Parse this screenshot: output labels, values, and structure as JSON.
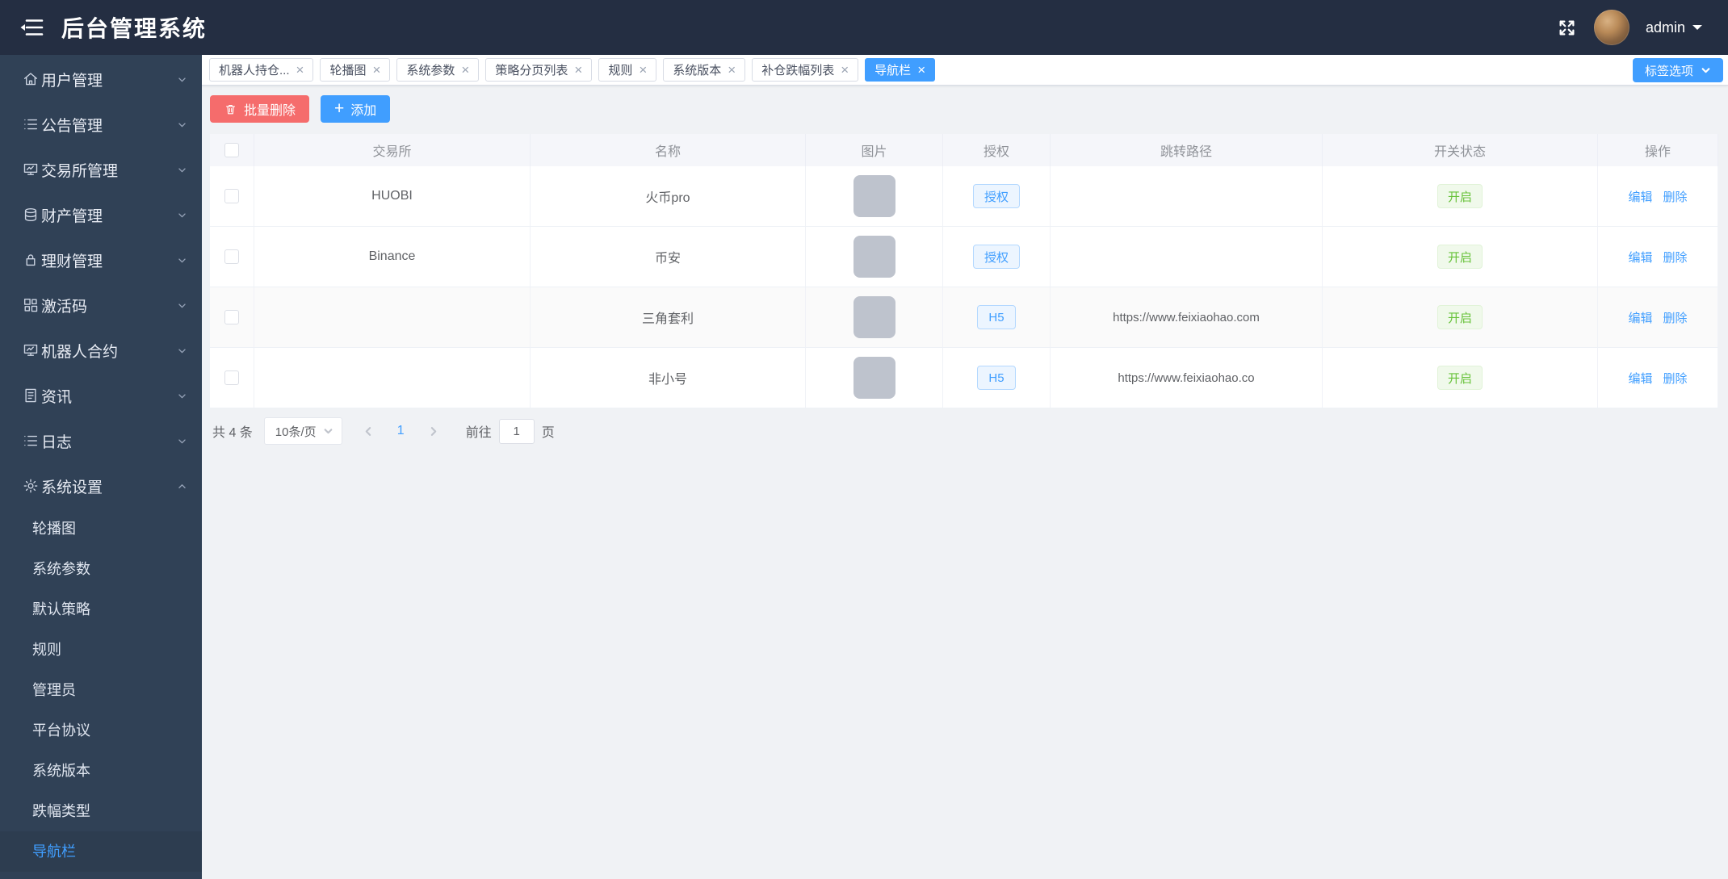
{
  "app": {
    "title": "后台管理系统",
    "user": "admin"
  },
  "colors": {
    "accent": "#409eff",
    "danger": "#f56c6c",
    "success": "#67c23a",
    "navbar_bg": "#242e42",
    "sidebar_bg": "#304156"
  },
  "sidebar": {
    "items": [
      {
        "label": "用户管理",
        "icon": "home-icon",
        "expanded": false
      },
      {
        "label": "公告管理",
        "icon": "list-icon",
        "expanded": false
      },
      {
        "label": "交易所管理",
        "icon": "board-icon",
        "expanded": false
      },
      {
        "label": "财产管理",
        "icon": "database-icon",
        "expanded": false
      },
      {
        "label": "理财管理",
        "icon": "lock-icon",
        "expanded": false
      },
      {
        "label": "激活码",
        "icon": "grid-icon",
        "expanded": false
      },
      {
        "label": "机器人合约",
        "icon": "board-icon",
        "expanded": false
      },
      {
        "label": "资讯",
        "icon": "document-icon",
        "expanded": false
      },
      {
        "label": "日志",
        "icon": "list-icon",
        "expanded": false
      },
      {
        "label": "系统设置",
        "icon": "gear-icon",
        "expanded": true
      }
    ],
    "submenu": {
      "parent": "系统设置",
      "items": [
        "轮播图",
        "系统参数",
        "默认策略",
        "规则",
        "管理员",
        "平台协议",
        "系统版本",
        "跌幅类型",
        "导航栏"
      ],
      "active": "导航栏"
    }
  },
  "tags": {
    "tabs": [
      {
        "label": "机器人持仓...",
        "active": false
      },
      {
        "label": "轮播图",
        "active": false
      },
      {
        "label": "系统参数",
        "active": false
      },
      {
        "label": "策略分页列表",
        "active": false
      },
      {
        "label": "规则",
        "active": false
      },
      {
        "label": "系统版本",
        "active": false
      },
      {
        "label": "补仓跌幅列表",
        "active": false
      },
      {
        "label": "导航栏",
        "active": true
      }
    ],
    "options_label": "标签选项"
  },
  "toolbar": {
    "batch_delete": "批量删除",
    "add": "添加"
  },
  "table": {
    "columns": [
      "交易所",
      "名称",
      "图片",
      "授权",
      "跳转路径",
      "开关状态",
      "操作"
    ],
    "rows": [
      {
        "exchange": "HUOBI",
        "name": "火币pro",
        "auth_action": "授权",
        "jump_path": "",
        "switch_status": "开启"
      },
      {
        "exchange": "Binance",
        "name": "币安",
        "auth_action": "授权",
        "jump_path": "",
        "switch_status": "开启"
      },
      {
        "exchange": "",
        "name": "三角套利",
        "auth_action": "H5",
        "jump_path": "https://www.feixiaohao.com",
        "switch_status": "开启"
      },
      {
        "exchange": "",
        "name": "非小号",
        "auth_action": "H5",
        "jump_path": "https://www.feixiaohao.co",
        "switch_status": "开启"
      }
    ],
    "action_labels": {
      "edit": "编辑",
      "delete": "删除"
    }
  },
  "pagination": {
    "total": "共 4 条",
    "per_page": "10条/页",
    "current_page": "1",
    "goto_label": "前往",
    "goto_value": "1",
    "page_unit": "页"
  }
}
